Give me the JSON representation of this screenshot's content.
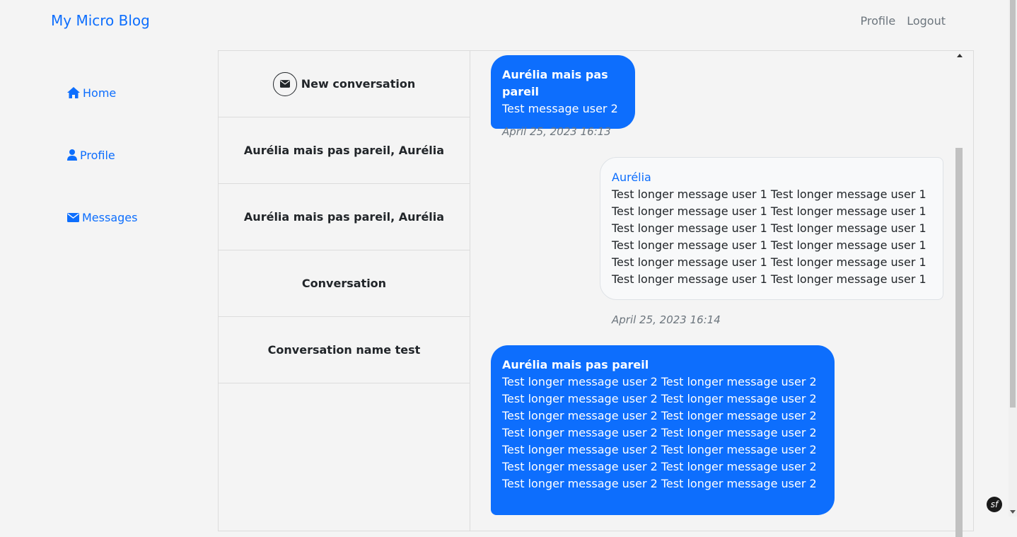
{
  "navbar": {
    "brand": "My Micro Blog",
    "links": [
      "Profile",
      "Logout"
    ]
  },
  "sidebar": {
    "items": [
      {
        "label": "Home",
        "icon": "home-icon"
      },
      {
        "label": "Profile",
        "icon": "user-icon"
      },
      {
        "label": "Messages",
        "icon": "envelope-icon"
      }
    ]
  },
  "conversations": {
    "new_label": "New conversation",
    "items": [
      "Aurélia mais pas pareil, Aurélia",
      "Aurélia mais pas pareil, Aurélia",
      "Conversation",
      "Conversation name test"
    ]
  },
  "messages": [
    {
      "author": "Aurélia mais pas pareil",
      "text": "Test message user 2",
      "time": "April 25, 2023 16:13",
      "style": "received"
    },
    {
      "author": "Aurélia",
      "text": "Test longer message user 1 Test longer message user 1 Test longer message user 1 Test longer message user 1 Test longer message user 1 Test longer message user 1 Test longer message user 1 Test longer message user 1 Test longer message user 1 Test longer message user 1 Test longer message user 1 Test longer message user 1",
      "time": "April 25, 2023 16:14",
      "style": "sent"
    },
    {
      "author": "Aurélia mais pas pareil",
      "text": "Test longer message user 2 Test longer message user 2 Test longer message user 2 Test longer message user 2 Test longer message user 2 Test longer message user 2 Test longer message user 2 Test longer message user 2 Test longer message user 2 Test longer message user 2 Test longer message user 2 Test longer message user 2 Test longer message user 2 Test longer message user 2",
      "style": "received"
    }
  ],
  "colors": {
    "accent": "#0d6efd",
    "background": "#f4f4f4"
  },
  "badge": "sf"
}
